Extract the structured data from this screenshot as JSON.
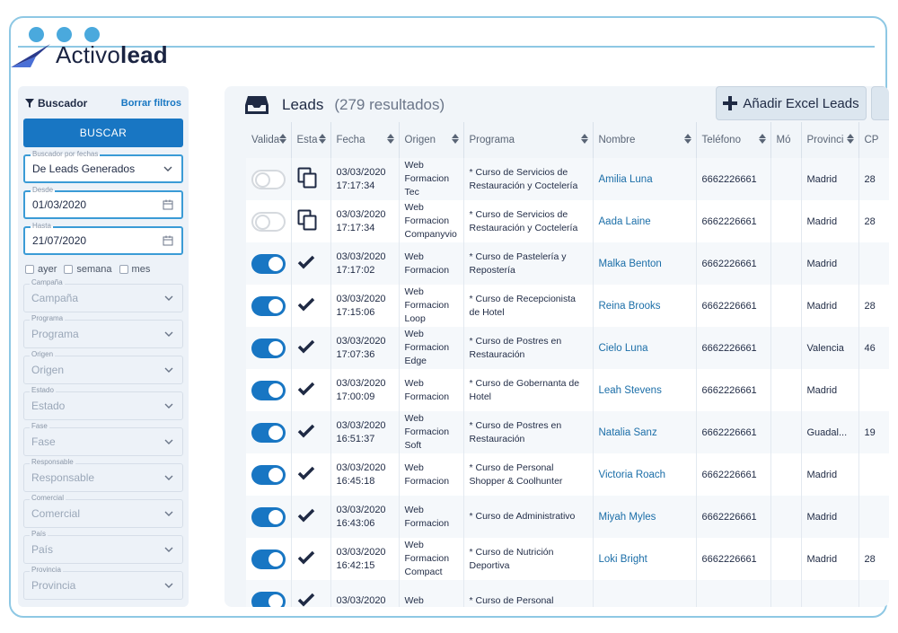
{
  "brand": {
    "name_light": "Activo",
    "name_bold": "lead"
  },
  "sidebar": {
    "title": "Buscador",
    "clear_label": "Borrar filtros",
    "search_button": "BUSCAR",
    "date_filter": {
      "label": "Buscador por fechas",
      "value": "De Leads Generados"
    },
    "from": {
      "label": "Desde",
      "value": "01/03/2020"
    },
    "to": {
      "label": "Hasta",
      "value": "21/07/2020"
    },
    "quick": [
      "ayer",
      "semana",
      "mes"
    ],
    "selects": [
      {
        "label": "Campaña",
        "value": "Campaña"
      },
      {
        "label": "Programa",
        "value": "Programa"
      },
      {
        "label": "Origen",
        "value": "Origen"
      },
      {
        "label": "Estado",
        "value": "Estado"
      },
      {
        "label": "Fase",
        "value": "Fase"
      },
      {
        "label": "Responsable",
        "value": "Responsable"
      },
      {
        "label": "Comercial",
        "value": "Comercial"
      },
      {
        "label": "País",
        "value": "País"
      },
      {
        "label": "Provincia",
        "value": "Provincia"
      }
    ]
  },
  "main": {
    "title": "Leads",
    "count": "(279 resultados)",
    "excel_button": "Añadir Excel Leads",
    "columns": [
      "Valida",
      "Esta",
      "Fecha",
      "Origen",
      "Programa",
      "Nombre",
      "Teléfono",
      "Mó",
      "Provinci",
      "CP"
    ],
    "rows": [
      {
        "valid": false,
        "state": "copy",
        "date": "03/03/2020",
        "time": "17:17:34",
        "origin": "Web Formacion Tec",
        "program": "* Curso de Servicios de Restauración y Coctelería",
        "name": "Amilia Luna",
        "phone": "6662226661",
        "province": "Madrid",
        "cp": "28"
      },
      {
        "valid": false,
        "state": "copy",
        "date": "03/03/2020",
        "time": "17:17:34",
        "origin": "Web Formacion Companyvio",
        "program": "* Curso de Servicios de Restauración y Coctelería",
        "name": "Aada Laine",
        "phone": "6662226661",
        "province": "Madrid",
        "cp": "28"
      },
      {
        "valid": true,
        "state": "check",
        "date": "03/03/2020",
        "time": "17:17:02",
        "origin": "Web Formacion",
        "program": "* Curso de Pastelería y Repostería",
        "name": "Malka Benton",
        "phone": "6662226661",
        "province": "Madrid",
        "cp": ""
      },
      {
        "valid": true,
        "state": "check",
        "date": "03/03/2020",
        "time": "17:15:06",
        "origin": "Web Formacion Loop",
        "program": "* Curso de Recepcionista de Hotel",
        "name": "Reina Brooks",
        "phone": "6662226661",
        "province": "Madrid",
        "cp": "28"
      },
      {
        "valid": true,
        "state": "check",
        "date": "03/03/2020",
        "time": "17:07:36",
        "origin": "Web Formacion Edge",
        "program": "* Curso de Postres en Restauración",
        "name": "Cielo Luna",
        "phone": "6662226661",
        "province": "Valencia",
        "cp": "46"
      },
      {
        "valid": true,
        "state": "check",
        "date": "03/03/2020",
        "time": "17:00:09",
        "origin": "Web Formacion",
        "program": "* Curso de Gobernanta de Hotel",
        "name": "Leah Stevens",
        "phone": "6662226661",
        "province": "Madrid",
        "cp": ""
      },
      {
        "valid": true,
        "state": "check",
        "date": "03/03/2020",
        "time": "16:51:37",
        "origin": "Web Formacion Soft",
        "program": "* Curso de Postres en Restauración",
        "name": "Natalia Sanz",
        "phone": "6662226661",
        "province": "Guadal...",
        "cp": "19"
      },
      {
        "valid": true,
        "state": "check",
        "date": "03/03/2020",
        "time": "16:45:18",
        "origin": "Web Formacion",
        "program": "* Curso de Personal Shopper & Coolhunter",
        "name": "Victoria Roach",
        "phone": "6662226661",
        "province": "Madrid",
        "cp": ""
      },
      {
        "valid": true,
        "state": "check",
        "date": "03/03/2020",
        "time": "16:43:06",
        "origin": "Web Formacion",
        "program": "* Curso de Administrativo",
        "name": "Miyah Myles",
        "phone": "6662226661",
        "province": "Madrid",
        "cp": ""
      },
      {
        "valid": true,
        "state": "check",
        "date": "03/03/2020",
        "time": "16:42:15",
        "origin": "Web Formacion Compact",
        "program": "* Curso de Nutrición Deportiva",
        "name": "Loki Bright",
        "phone": "6662226661",
        "province": "Madrid",
        "cp": "28"
      },
      {
        "valid": true,
        "state": "check",
        "date": "03/03/2020",
        "time": "",
        "origin": "Web",
        "program": "* Curso de Personal",
        "name": "",
        "phone": "",
        "province": "",
        "cp": ""
      }
    ]
  },
  "colors": {
    "accent": "#1876c3",
    "frame": "#8ec8e4",
    "link": "#1b6ea8"
  }
}
